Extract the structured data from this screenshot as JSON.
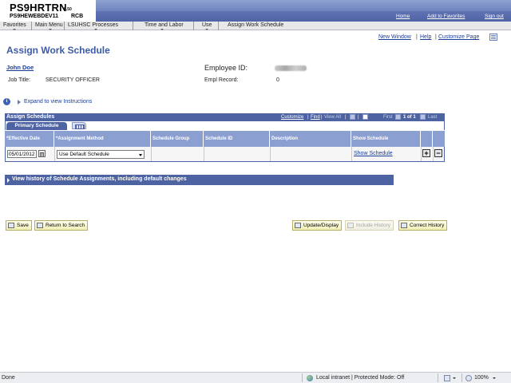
{
  "header": {
    "system": "PS9HRTRN",
    "version": "8.50",
    "database": "PS9HEWEBDEV11",
    "server": "RCB",
    "links": [
      "Home",
      "Add to Favorites",
      "Sign out"
    ]
  },
  "menu": [
    "Favorites",
    "Main Menu",
    "LSUHSC Processes",
    "Time and Labor",
    "Use",
    "Assign Work Schedule"
  ],
  "page_links": {
    "new_window": "New Window",
    "help": "Help",
    "customize": "Customize Page",
    "separator": "|"
  },
  "page": {
    "title": "Assign Work Schedule",
    "employee_name": "John Doe",
    "job_title_label": "Job Title:",
    "job_title": "SECURITY OFFICER",
    "employee_id_label": "Employee ID:",
    "empl_record_label": "Empl Record:",
    "empl_record": "0",
    "expand_label": "Expand to view Instructions"
  },
  "grid": {
    "title": "Assign Schedules",
    "customize": "Customize",
    "find": "Find",
    "view_all": "View All",
    "first": "First",
    "range": "1 of 1",
    "last": "Last",
    "tab": "Primary Schedule",
    "columns": [
      "*Effective Date",
      "*Assignment Method",
      "Schedule Group",
      "Schedule ID",
      "Description",
      "Show Schedule"
    ],
    "row": {
      "effective_date": "05/01/2012",
      "assignment_method": "Use Default Schedule",
      "show_schedule": "Show Schedule",
      "add": "+",
      "delete": "−"
    }
  },
  "history_label": "View history of Schedule Assignments, including default changes",
  "buttons": {
    "save": "Save",
    "return": "Return to Search",
    "update": "Update/Display",
    "include": "Include History",
    "correct": "Correct History"
  },
  "status": {
    "left": "Done",
    "zone": "Local intranet | Protected Mode: Off",
    "zoom": "100%"
  },
  "colors": {
    "header_blue": "#4d63a2",
    "column_blue": "#8b9fd0",
    "link_blue": "#1a3d9c",
    "title_blue": "#3e5ba8"
  }
}
